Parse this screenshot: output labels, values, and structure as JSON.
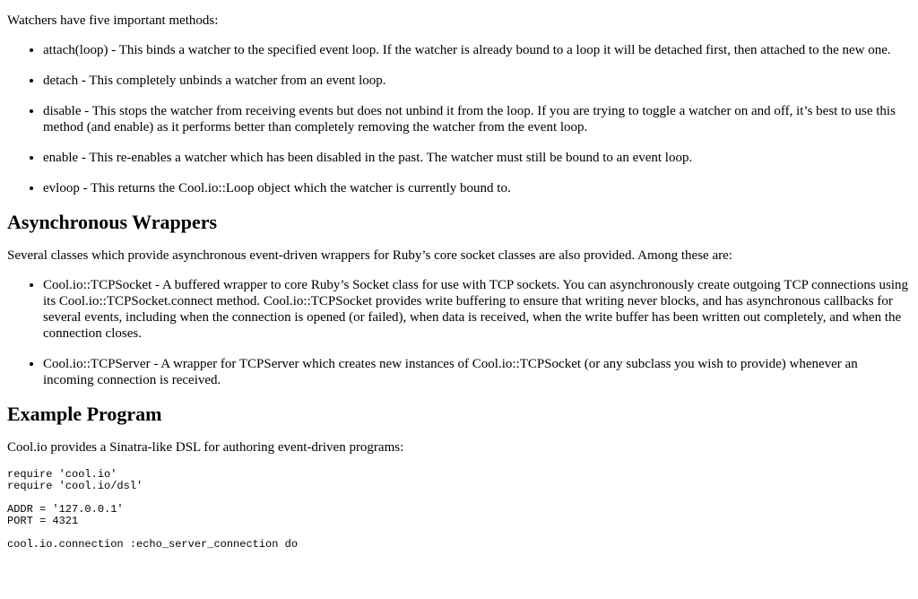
{
  "watchers": {
    "intro": "Watchers have five important methods:",
    "methods": [
      "attach(loop) - This binds a watcher to the specified event loop. If the watcher is already bound to a loop it will be detached first, then attached to the new one.",
      "detach - This completely unbinds a watcher from an event loop.",
      "disable - This stops the watcher from receiving events but does not unbind it from the loop. If you are trying to toggle a watcher on and off, it’s best to use this method (and enable) as it performs better than completely removing the watcher from the event loop.",
      "enable - This re-enables a watcher which has been disabled in the past. The watcher must still be bound to an event loop.",
      "evloop - This returns the Cool.io::Loop object which the watcher is currently bound to."
    ]
  },
  "async_wrappers": {
    "heading": "Asynchronous Wrappers",
    "intro": "Several classes which provide asynchronous event-driven wrappers for Ruby’s core socket classes are also provided. Among these are:",
    "items": [
      "Cool.io::TCPSocket - A buffered wrapper to core Ruby’s Socket class for use with TCP sockets. You can asynchronously create outgoing TCP connections using its Cool.io::TCPSocket.connect method. Cool.io::TCPSocket provides write buffering to ensure that writing never blocks, and has asynchronous callbacks for several events, including when the connection is opened (or failed), when data is received, when the write buffer has been written out completely, and when the connection closes.",
      "Cool.io::TCPServer - A wrapper for TCPServer which creates new instances of Cool.io::TCPSocket (or any subclass you wish to provide) whenever an incoming connection is received."
    ]
  },
  "example": {
    "heading": "Example Program",
    "intro": "Cool.io provides a Sinatra-like DSL for authoring event-driven programs:",
    "code_blocks": [
      "require 'cool.io'\nrequire 'cool.io/dsl'",
      "ADDR = '127.0.0.1'\nPORT = 4321",
      "cool.io.connection :echo_server_connection do"
    ]
  }
}
